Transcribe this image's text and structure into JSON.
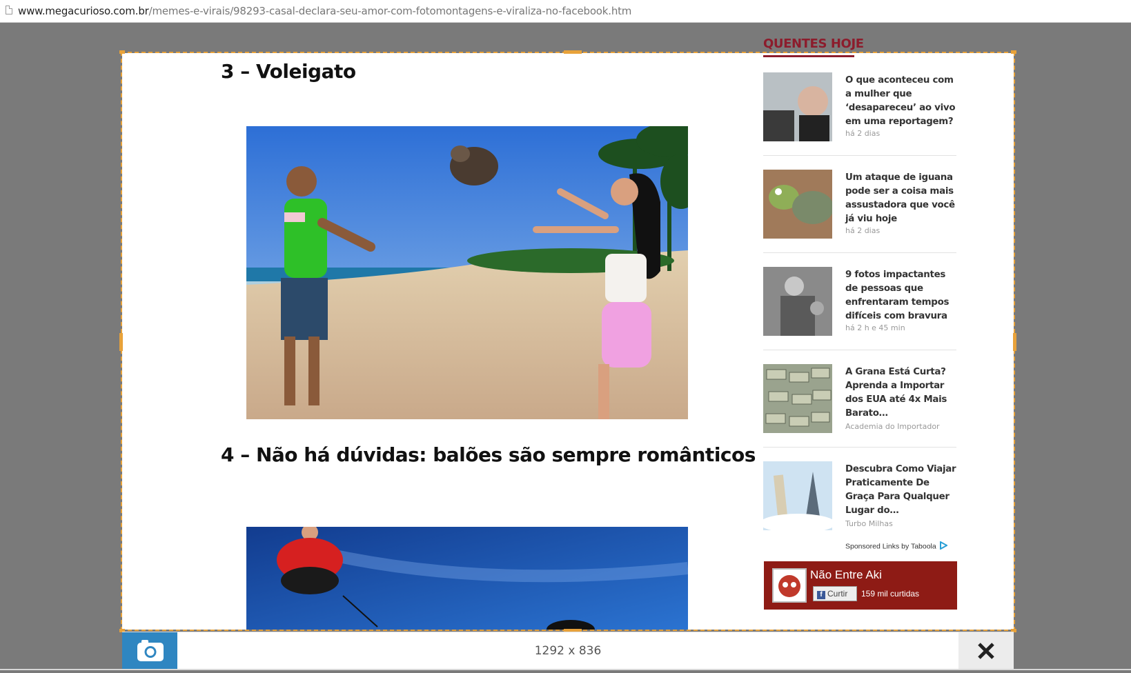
{
  "browser": {
    "url_host": "www.megacurioso.com.br",
    "url_path": "/memes-e-virais/98293-casal-declara-seu-amor-com-fotomontagens-e-viraliza-no-facebook.htm"
  },
  "article": {
    "heading_3": "3 – Voleigato",
    "heading_4": "4 – Não há dúvidas: balões são sempre românticos"
  },
  "sidebar": {
    "title": "QUENTES HOJE",
    "stories": [
      {
        "title": "O que aconteceu com a mulher que ‘desapareceu’ ao vivo em uma reportagem?",
        "meta": "há 2 dias"
      },
      {
        "title": "Um ataque de iguana pode ser a coisa mais assustadora que você já viu hoje",
        "meta": "há 2 dias"
      },
      {
        "title": "9 fotos impactantes de pessoas que enfrentaram tempos difíceis com bravura",
        "meta": "há 2 h e 45 min"
      },
      {
        "title": "A Grana Está Curta? Aprenda a Importar dos EUA até 4x Mais Barato…",
        "meta": "Academia do Importador"
      },
      {
        "title": "Descubra Como Viajar Praticamente De Graça Para Qualquer Lugar do…",
        "meta": "Turbo Milhas"
      }
    ],
    "sponsored": "Sponsored Links by Taboola",
    "fb": {
      "name": "Não Entre Aki",
      "like_label": "Curtir",
      "count": "159 mil curtidas"
    }
  },
  "toolbar": {
    "size_label": "1292 x 836"
  },
  "colors": {
    "accent": "#8c1c2c",
    "capture_border": "#e8a23a",
    "camera_button": "#2f86c1"
  },
  "icons": [
    "page-icon",
    "camera-icon",
    "close-icon",
    "taboola-icon",
    "facebook-icon"
  ]
}
